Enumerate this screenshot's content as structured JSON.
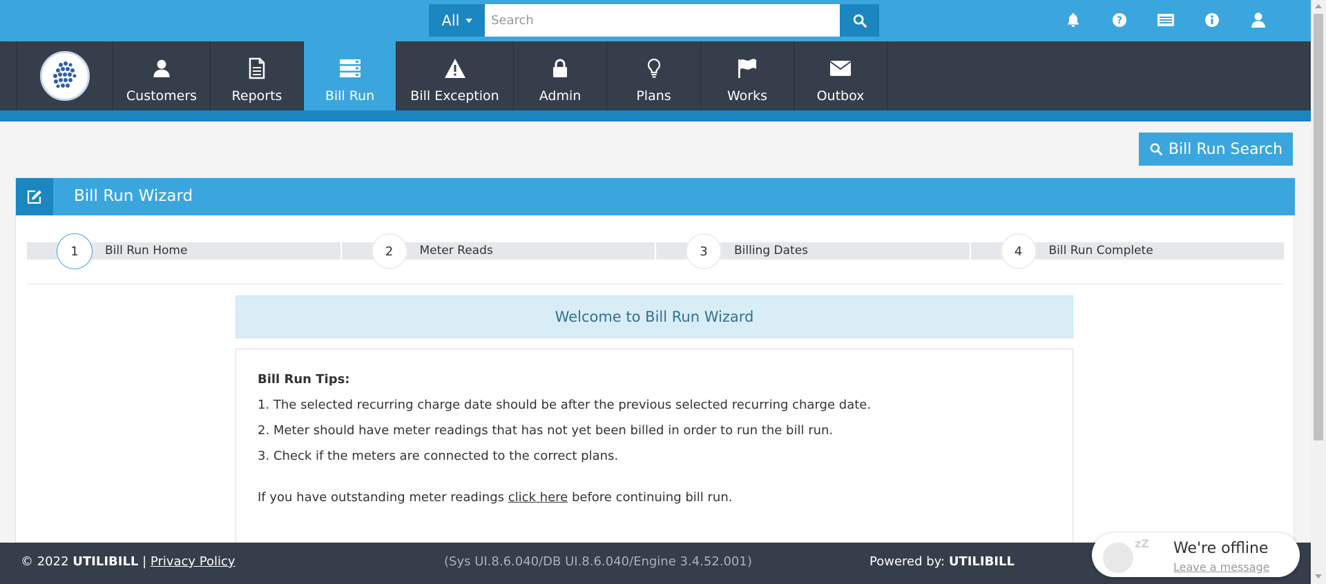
{
  "search": {
    "scope_label": "All",
    "placeholder": "Search",
    "value": ""
  },
  "top_icons": [
    "bell-icon",
    "question-circle-icon",
    "id-card-icon",
    "info-circle-icon",
    "user-icon"
  ],
  "nav": {
    "items": [
      {
        "label": "Customers",
        "icon": "user-icon"
      },
      {
        "label": "Reports",
        "icon": "document-icon"
      },
      {
        "label": "Bill Run",
        "icon": "server-icon",
        "active": true
      },
      {
        "label": "Bill Exception",
        "icon": "warning-icon"
      },
      {
        "label": "Admin",
        "icon": "lock-icon"
      },
      {
        "label": "Plans",
        "icon": "lightbulb-icon"
      },
      {
        "label": "Works",
        "icon": "flag-icon"
      },
      {
        "label": "Outbox",
        "icon": "envelope-icon"
      }
    ]
  },
  "bill_run_search_label": "Bill Run Search",
  "panel": {
    "title": "Bill Run Wizard",
    "steps": [
      {
        "number": "1",
        "label": "Bill Run Home",
        "active": true
      },
      {
        "number": "2",
        "label": "Meter Reads"
      },
      {
        "number": "3",
        "label": "Billing Dates"
      },
      {
        "number": "4",
        "label": "Bill Run Complete"
      }
    ],
    "welcome": "Welcome to Bill Run Wizard",
    "tips_title": "Bill Run Tips:",
    "tips": [
      "1. The selected recurring charge date should be after the previous selected recurring charge date.",
      "2. Meter should have meter readings that has not yet been billed in order to run the bill run.",
      "3. Check if the meters are connected to the correct plans."
    ],
    "outstanding_prefix": "If you have outstanding meter readings ",
    "outstanding_link": "click here",
    "outstanding_suffix": " before continuing bill run."
  },
  "footer": {
    "copyright": "© 2022 ",
    "brand": "UTILIBILL",
    "separator": " | ",
    "privacy": "Privacy Policy",
    "version": "(Sys UI.8.6.040/DB UI.8.6.040/Engine 3.4.52.001)",
    "powered_prefix": "Powered by: ",
    "powered_brand": "UTILIBILL"
  },
  "chat": {
    "status": "We're offline",
    "action": "Leave a message"
  },
  "colors": {
    "primary": "#3aa6dd",
    "primary_dark": "#1b86c0",
    "nav_bg": "#363e4b",
    "welcome_bg": "#d9edf7",
    "welcome_text": "#31708f"
  }
}
